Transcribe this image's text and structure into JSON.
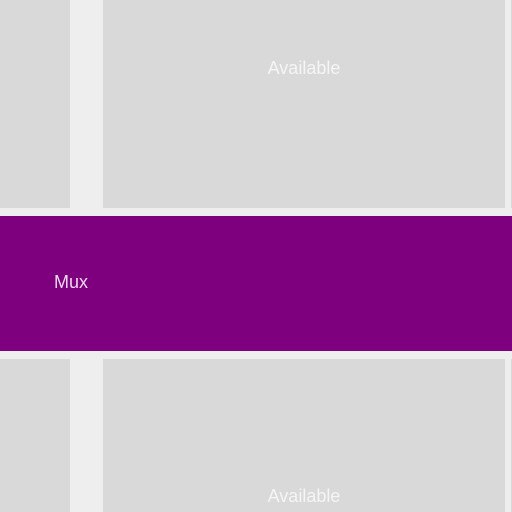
{
  "colors": {
    "background": "#eeeeee",
    "block": "#d9d9d9",
    "accent": "#7e007e"
  },
  "blocks": {
    "top_available": {
      "label": "Available"
    },
    "mux": {
      "label": "Mux"
    },
    "bottom_available": {
      "label": "Available"
    }
  }
}
